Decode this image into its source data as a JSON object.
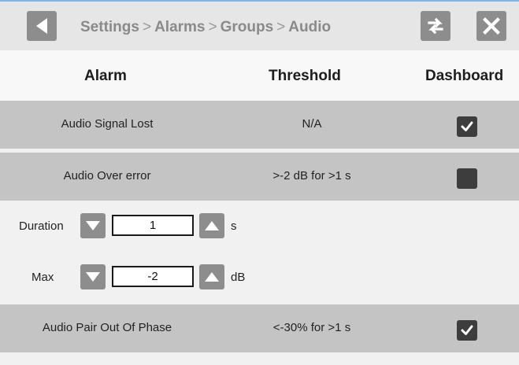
{
  "breadcrumb": {
    "items": [
      "Settings",
      "Alarms",
      "Groups",
      "Audio"
    ],
    "separator": ">"
  },
  "toolbar": {
    "back_icon": "back-arrow-icon",
    "swap_icon": "swap-icon",
    "close_icon": "close-icon"
  },
  "columns": {
    "alarm": "Alarm",
    "threshold": "Threshold",
    "dashboard": "Dashboard"
  },
  "alarms": [
    {
      "name": "Audio Signal Lost",
      "threshold": "N/A",
      "dashboard": true
    },
    {
      "name": "Audio Over error",
      "threshold": ">-2 dB for >1 s",
      "dashboard": false
    },
    {
      "name": "Audio Pair Out Of Phase",
      "threshold": "<-30% for >1 s",
      "dashboard": true
    }
  ],
  "editor": {
    "duration": {
      "label": "Duration",
      "value": "1",
      "unit": "s"
    },
    "max": {
      "label": "Max",
      "value": "-2",
      "unit": "dB"
    }
  },
  "colors": {
    "toolbar_bg": "#e6e6e6",
    "row_bg": "#c4c4c4",
    "button_gray": "#8d8d8d",
    "checkbox": "#3d3d3d"
  }
}
